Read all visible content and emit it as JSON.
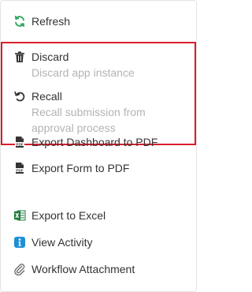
{
  "menu": {
    "refresh": {
      "label": "Refresh",
      "icon": "refresh-icon",
      "color": "#2aa85a"
    },
    "discard": {
      "label": "Discard",
      "sub": "Discard app instance",
      "icon": "trash-icon"
    },
    "recall": {
      "label": "Recall",
      "sub_line1": "Recall submission from",
      "sub_line2": "approval process",
      "icon": "undo-icon"
    },
    "export_dashboard_pdf": {
      "label": "Export Dashboard to PDF",
      "icon": "pdf-icon"
    },
    "export_form_pdf": {
      "label": "Export Form to PDF",
      "icon": "pdf-icon"
    },
    "export_excel": {
      "label": "Export to Excel",
      "icon": "excel-icon",
      "color": "#1e7a3c"
    },
    "view_activity": {
      "label": "View Activity",
      "icon": "info-icon",
      "color": "#1e8fd6"
    },
    "workflow_attachment": {
      "label": "Workflow Attachment",
      "icon": "paperclip-icon"
    }
  },
  "highlight_color": "#d81e2c"
}
